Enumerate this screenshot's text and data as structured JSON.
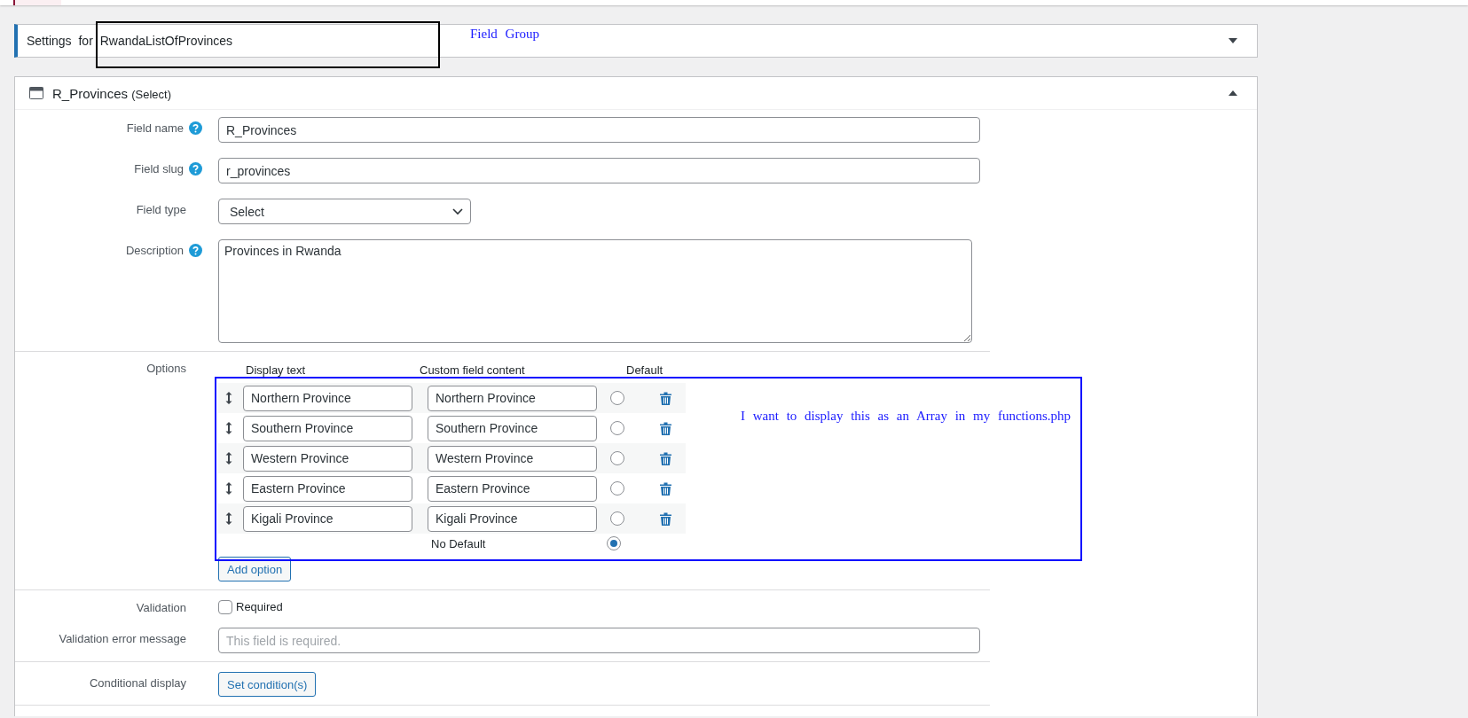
{
  "settings_panel": {
    "title": "Settings for RwandaListOfProvinces",
    "expanded": false
  },
  "field_panel": {
    "title": "R_Provinces",
    "type_label": "(Select)",
    "expanded": true,
    "rows": [
      {
        "kind": "text",
        "label": "Field name",
        "help": true,
        "value": "R_Provinces"
      },
      {
        "kind": "text",
        "label": "Field slug",
        "help": true,
        "value": "r_provinces"
      },
      {
        "kind": "select",
        "label": "Field type",
        "help": false,
        "value": "Select"
      },
      {
        "kind": "textarea",
        "label": "Description",
        "help": true,
        "value": "Provinces in Rwanda"
      }
    ],
    "options": {
      "label": "Options",
      "headers": [
        "Display text",
        "Custom field content",
        "Default"
      ],
      "items": [
        {
          "display": "Northern Province",
          "content": "Northern Province",
          "selected": false
        },
        {
          "display": "Southern Province",
          "content": "Southern Province",
          "selected": false
        },
        {
          "display": "Western Province",
          "content": "Western Province",
          "selected": false
        },
        {
          "display": "Eastern Province",
          "content": "Eastern Province",
          "selected": false
        },
        {
          "display": "Kigali Province",
          "content": "Kigali Province",
          "selected": false
        }
      ],
      "no_default": {
        "label": "No Default",
        "selected": true
      },
      "add_button": "Add option"
    },
    "validation": {
      "label": "Validation",
      "checkbox_label": "Required",
      "checked": false
    },
    "error_message": {
      "label": "Validation error message",
      "placeholder": "This field is required."
    },
    "conditional": {
      "label": "Conditional display",
      "button": "Set condition(s)"
    }
  },
  "annotations": {
    "field_group_note": "Field Group",
    "array_note": "I want to display this as an Array in my functions.php"
  }
}
